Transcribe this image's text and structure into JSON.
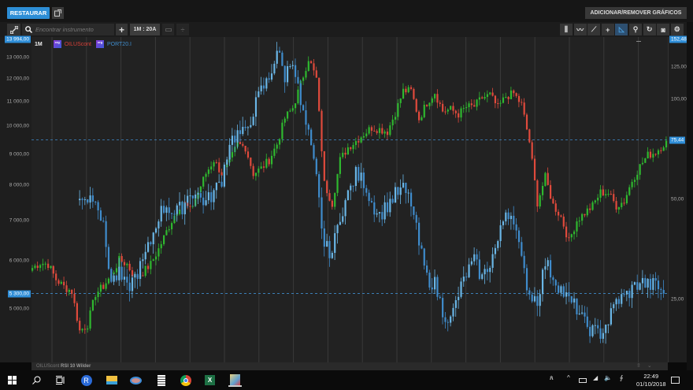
{
  "header": {
    "restore_label": "RESTAURAR",
    "add_remove_label": "ADICIONAR/REMOVER GRÁFICOS"
  },
  "toolbar": {
    "search_placeholder": "Encontrar instrumento",
    "period_label": "1M : 20A",
    "right_tools": [
      "bars-style-icon",
      "line-style-icon",
      "trendline-icon",
      "crosshair-icon",
      "area-style-icon",
      "zoom-icon",
      "refresh-icon",
      "camera-icon",
      "gear-icon"
    ]
  },
  "legend": {
    "interval": "1M",
    "series1": "OILUScont",
    "series2": "PORT20.I",
    "badge": "crg"
  },
  "axes": {
    "left_ticks": [
      "13 000,00",
      "12 000,00",
      "11 000,00",
      "10 000,00",
      "9 000,00",
      "8 000,00",
      "7 000,00",
      "6 000,00",
      "5 000,00"
    ],
    "left_top_label": "13 994,00",
    "left_current_label": "5 300,00",
    "right_ticks": [
      "125,00",
      "100,00",
      "50,00",
      "25,00"
    ],
    "right_top_label": "152,48",
    "right_current_label": "75,44"
  },
  "bottom_pane": {
    "instrument": "OILUScont",
    "indicator": "RSI 10 Wilder"
  },
  "taskbar": {
    "time": "22:49",
    "date": "01/10/2018"
  },
  "colors": {
    "up": "#2fb82f",
    "down": "#e04a3c",
    "psi_up": "#6ab6e6",
    "psi_down": "#3f8ccc",
    "accent": "#2d8ed6"
  },
  "chart_data": {
    "type": "candlestick",
    "interval": "1M",
    "range": "20A",
    "grid": true,
    "series": [
      {
        "name": "OILUScont",
        "axis": "right",
        "scale": "log",
        "start": "1998-10",
        "sample_step": "3M",
        "closes": [
          31.1,
          32.2,
          31.9,
          28.7,
          27.3,
          26.4,
          20.1,
          21.0,
          26.0,
          27.4,
          29.5,
          32.8,
          31.9,
          29.0,
          30.2,
          31.9,
          35.4,
          40.0,
          44.8,
          49.4,
          46.3,
          52.5,
          59.8,
          65.7,
          59.8,
          65.0,
          73.3,
          71.7,
          59.8,
          61.9,
          65.7,
          73.3,
          87.7,
          94.2,
          111,
          133,
          115,
          55.7,
          48.7,
          65.7,
          71.7,
          74.9,
          78.7,
          82.2,
          81.3,
          80.0,
          91.2,
          106,
          106,
          87.2,
          97.8,
          105,
          92.2,
          93.2,
          90.2,
          94.7,
          95.2,
          101,
          103,
          94.2,
          102,
          104,
          96.3,
          74.5,
          48.9,
          58.3,
          48.1,
          44.3,
          37.4,
          43.2,
          45.5,
          47.8,
          52.5,
          52.2,
          47.8,
          49.4,
          57.0,
          62.9,
          67.9,
          69.4,
          73.3,
          75.44
        ]
      },
      {
        "name": "PORT20.I",
        "axis": "left",
        "scale": "log",
        "start": "2000-04",
        "sample_step": "3M",
        "closes": [
          7720,
          7600,
          7720,
          6790,
          5550,
          5700,
          5390,
          5650,
          5970,
          6450,
          7140,
          7420,
          7160,
          7380,
          7810,
          7690,
          7490,
          7790,
          8190,
          9460,
          9720,
          9720,
          10630,
          11460,
          11980,
          13390,
          12090,
          13000,
          10860,
          9630,
          8190,
          6330,
          6200,
          7140,
          7720,
          8340,
          8120,
          7490,
          7140,
          7420,
          7720,
          7880,
          7490,
          6390,
          5620,
          5500,
          4960,
          4780,
          5280,
          5720,
          6000,
          5620,
          5970,
          6450,
          7270,
          7100,
          5970,
          5290,
          5180,
          5970,
          5650,
          5390,
          5150,
          5015,
          4720,
          4600,
          4560,
          4780,
          5150,
          5230,
          5390,
          5550,
          5470,
          5480,
          5300
        ]
      }
    ],
    "reference_lines": [
      {
        "axis": "right",
        "value": 75.44
      },
      {
        "axis": "left",
        "value": 5300
      }
    ]
  }
}
